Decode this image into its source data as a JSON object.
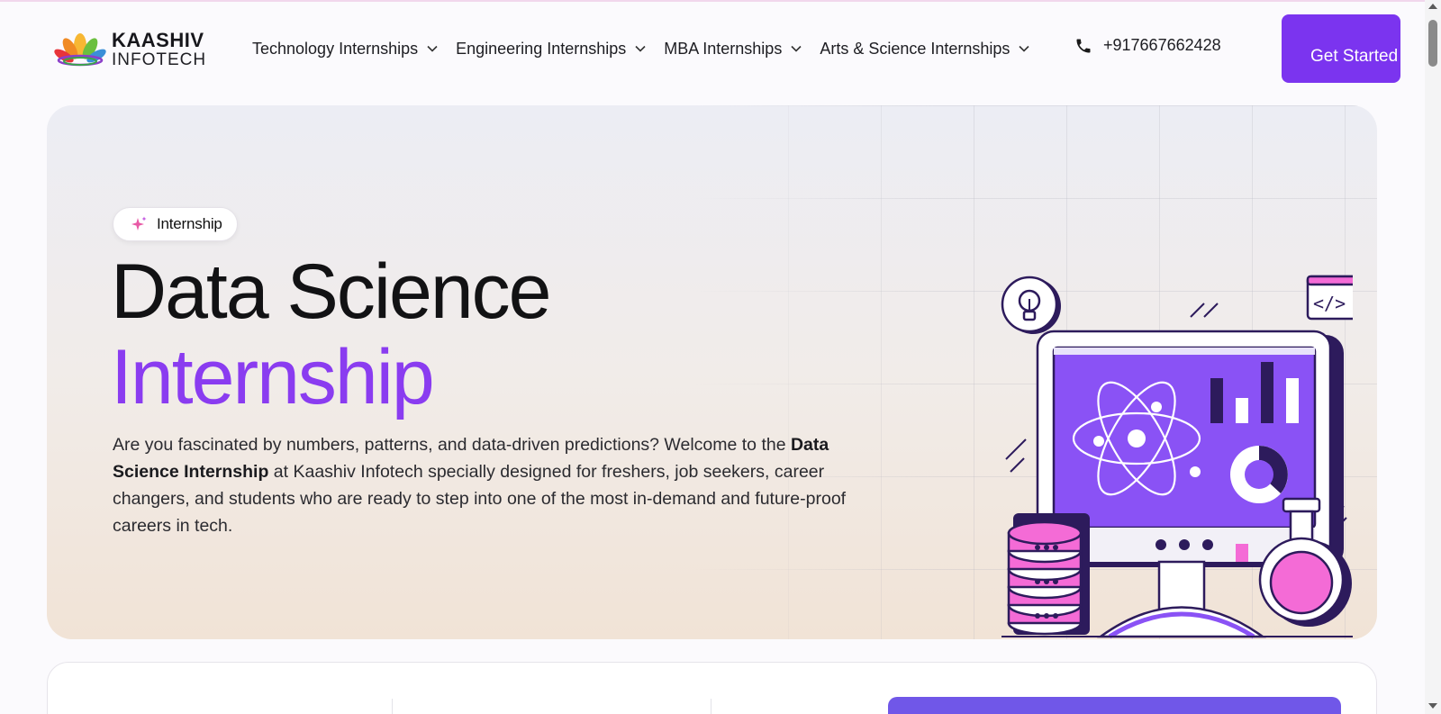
{
  "brand": {
    "line1": "KAASHIV",
    "line2": "INFOTECH"
  },
  "nav": {
    "items": [
      {
        "label": "Technology Internships"
      },
      {
        "label": "Engineering Internships"
      },
      {
        "label": "MBA Internships"
      },
      {
        "label": "Arts & Science Internships"
      }
    ],
    "phone": "+917667662428",
    "cta_label": "Get Started"
  },
  "hero": {
    "badge": "Internship",
    "title_line1": "Data Science",
    "title_line2": "Internship",
    "desc_before": "Are you fascinated by numbers, patterns, and data-driven predictions? Welcome to the ",
    "desc_bold": "Data Science Internship",
    "desc_after": " at Kaashiv Infotech specially designed for freshers, job seekers, career changers, and students who are ready to step into one of the most in-demand and future-proof careers in tech."
  },
  "colors": {
    "accent": "#7b34ef",
    "accent_title": "#8a3cf0",
    "secondary_button": "#7057e8",
    "pink": "#f46bd6"
  },
  "icons": [
    "logo-flower-icon",
    "chevron-down-icon",
    "phone-icon",
    "sparkle-icon",
    "lightbulb-icon",
    "code-window-icon",
    "atom-icon",
    "database-icon",
    "flask-icon"
  ]
}
